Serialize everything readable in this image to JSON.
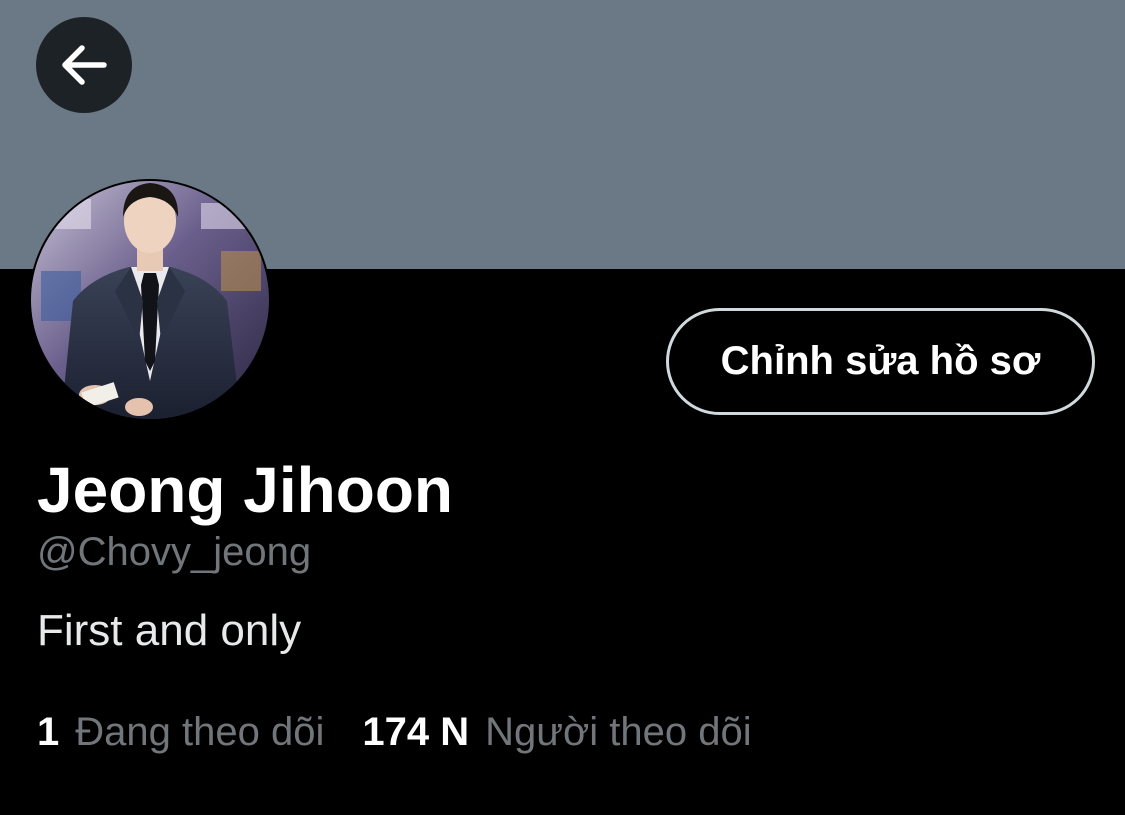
{
  "colors": {
    "banner": "#6b7885",
    "background": "#000000",
    "text_primary": "#ffffff",
    "text_secondary": "#71767b",
    "back_button_bg": "#1d2226",
    "button_border": "#cfd9de"
  },
  "header": {
    "back_icon": "arrow-left-icon"
  },
  "profile": {
    "edit_button_label": "Chỉnh sửa hồ sơ",
    "display_name": "Jeong Jihoon",
    "handle": "@Chovy_jeong",
    "bio": "First and only",
    "avatar": "profile-photo-man-in-suit"
  },
  "stats": {
    "following_count": "1",
    "following_label": "Đang theo dõi",
    "followers_count": "174 N",
    "followers_label": "Người theo dõi"
  }
}
